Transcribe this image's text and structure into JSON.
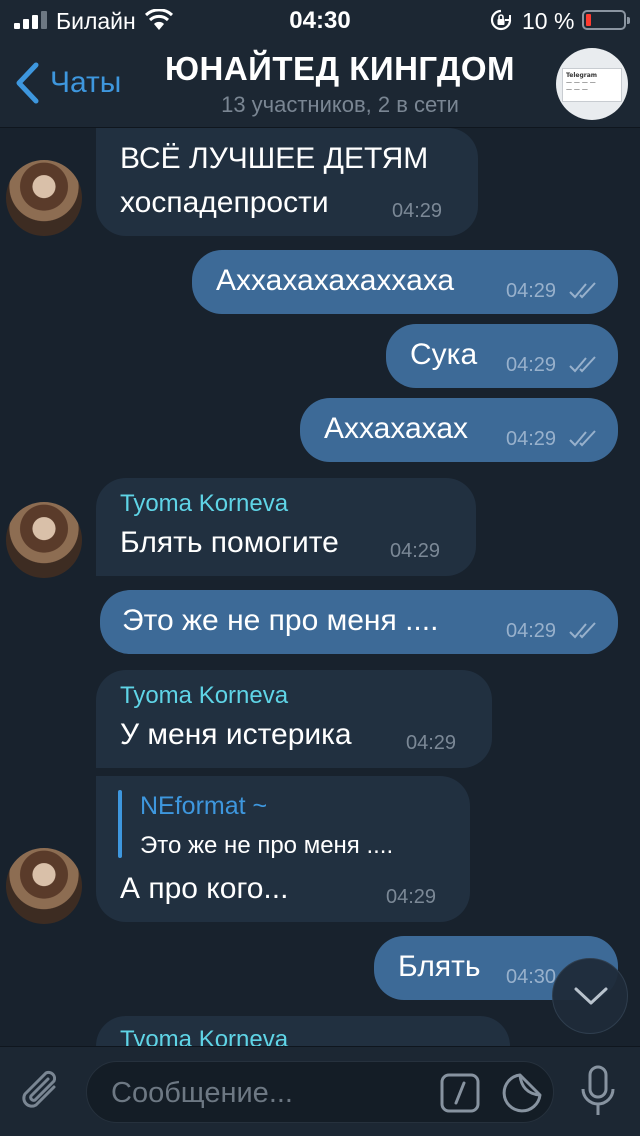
{
  "status": {
    "carrier": "Билайн",
    "time": "04:30",
    "battery": "10 %"
  },
  "nav": {
    "back_label": "Чаты",
    "title": "ЮНАЙТЕД КИНГДОМ",
    "subtitle": "13 участников, 2 в сети"
  },
  "messages": [
    {
      "dir": "in",
      "line1": "ВСЁ ЛУЧШЕЕ ДЕТЯМ",
      "line2": "хоспадепрости",
      "time": "04:29"
    },
    {
      "dir": "out",
      "text": "Аххахахахаххаха",
      "time": "04:29"
    },
    {
      "dir": "out",
      "text": "Сука",
      "time": "04:29"
    },
    {
      "dir": "out",
      "text": "Аххахахах",
      "time": "04:29"
    },
    {
      "dir": "in",
      "sender": "Tyoma Korneva",
      "text": "Блять помогите",
      "time": "04:29"
    },
    {
      "dir": "out",
      "text": "Это же не про меня ....",
      "time": "04:29"
    },
    {
      "dir": "in",
      "sender": "Tyoma Korneva",
      "text": "У меня истерика",
      "time": "04:29"
    },
    {
      "dir": "in",
      "reply_name": "NEformat ~",
      "reply_text": "Это же не про меня ....",
      "text": "А про кого...",
      "time": "04:29"
    },
    {
      "dir": "out",
      "text": "Блять",
      "time": "04:30"
    },
    {
      "dir": "in",
      "sender": "Tyoma Korneva"
    }
  ],
  "input": {
    "placeholder": "Сообщение..."
  },
  "colors": {
    "accent": "#3e97de",
    "outgoing_bubble": "#3d6a97",
    "incoming_bubble": "#213040",
    "sender_name": "#5fd4e6",
    "background": "#18222d"
  },
  "icons": [
    "signal-icon",
    "wifi-icon",
    "rotation-lock-icon",
    "battery-icon",
    "back-chevron-icon",
    "chat-avatar",
    "read-ticks-icon",
    "scroll-down-icon",
    "attach-icon",
    "command-icon",
    "sticker-icon",
    "microphone-icon"
  ]
}
